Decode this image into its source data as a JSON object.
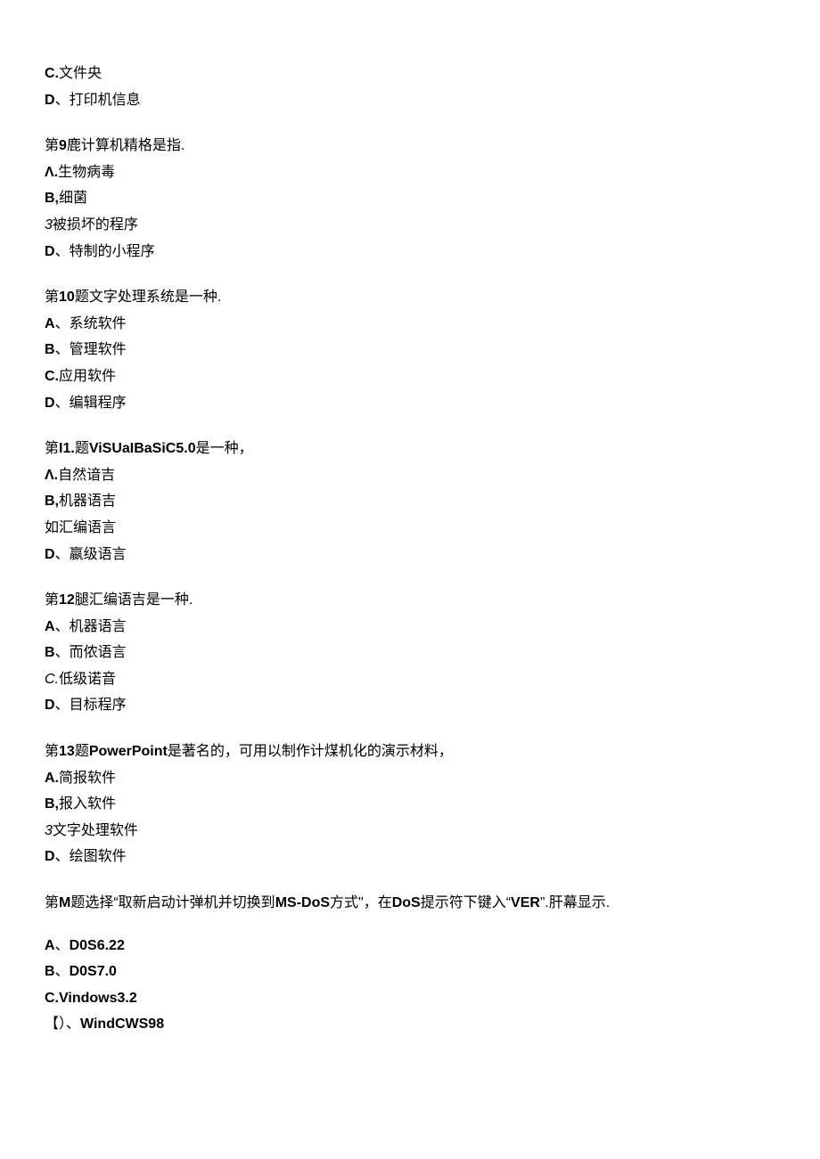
{
  "lines": [
    {
      "segments": [
        {
          "text": "C.",
          "bold": true
        },
        {
          "text": "文件央"
        }
      ]
    },
    {
      "segments": [
        {
          "text": "D",
          "bold": true
        },
        {
          "text": "、打印机信息"
        }
      ],
      "endBlock": true
    },
    {
      "segments": [
        {
          "text": "第"
        },
        {
          "text": "9",
          "bold": true
        },
        {
          "text": "鹿计算机精格是指."
        }
      ]
    },
    {
      "segments": [
        {
          "text": "Λ.",
          "bold": true
        },
        {
          "text": "生物病毒"
        }
      ]
    },
    {
      "segments": [
        {
          "text": "B,",
          "bold": true
        },
        {
          "text": "细菌"
        }
      ]
    },
    {
      "segments": [
        {
          "text": "3",
          "italic": true
        },
        {
          "text": "被损坏的程序"
        }
      ]
    },
    {
      "segments": [
        {
          "text": "D",
          "bold": true
        },
        {
          "text": "、特制的小程序"
        }
      ],
      "endBlock": true
    },
    {
      "segments": [
        {
          "text": "第"
        },
        {
          "text": "10",
          "bold": true
        },
        {
          "text": "题文字处理系统是一种."
        }
      ]
    },
    {
      "segments": [
        {
          "text": "A",
          "bold": true
        },
        {
          "text": "、系统软件"
        }
      ]
    },
    {
      "segments": [
        {
          "text": "B",
          "bold": true
        },
        {
          "text": "、管理软件"
        }
      ]
    },
    {
      "segments": [
        {
          "text": "C.",
          "bold": true
        },
        {
          "text": "应用软件"
        }
      ]
    },
    {
      "segments": [
        {
          "text": "D",
          "bold": true
        },
        {
          "text": "、编辑程序"
        }
      ],
      "endBlock": true
    },
    {
      "segments": [
        {
          "text": "第"
        },
        {
          "text": "I1.",
          "bold": true
        },
        {
          "text": "题"
        },
        {
          "text": "ViSUaIBaSiC5.0",
          "bold": true
        },
        {
          "text": "是一种，"
        }
      ]
    },
    {
      "segments": [
        {
          "text": "Λ.",
          "bold": true
        },
        {
          "text": "自然谙吉"
        }
      ]
    },
    {
      "segments": [
        {
          "text": "B,",
          "bold": true
        },
        {
          "text": "机器语吉"
        }
      ]
    },
    {
      "segments": [
        {
          "text": "如汇编语言"
        }
      ]
    },
    {
      "segments": [
        {
          "text": "D",
          "bold": true
        },
        {
          "text": "、嬴级语言"
        }
      ],
      "endBlock": true
    },
    {
      "segments": [
        {
          "text": "第"
        },
        {
          "text": "12",
          "bold": true
        },
        {
          "text": "腿汇编语吉是一种."
        }
      ]
    },
    {
      "segments": [
        {
          "text": "A",
          "bold": true
        },
        {
          "text": "、机器语言"
        }
      ]
    },
    {
      "segments": [
        {
          "text": "B",
          "bold": true
        },
        {
          "text": "、而侬语言"
        }
      ]
    },
    {
      "segments": [
        {
          "text": "C.",
          "italic": true
        },
        {
          "text": "低级诺音"
        }
      ]
    },
    {
      "segments": [
        {
          "text": "D",
          "bold": true
        },
        {
          "text": "、目标程序"
        }
      ],
      "endBlock": true
    },
    {
      "segments": [
        {
          "text": "第"
        },
        {
          "text": "13",
          "bold": true
        },
        {
          "text": "题"
        },
        {
          "text": "PowerPoint",
          "bold": true
        },
        {
          "text": "是著名的，可用以制作计煤机化的演示材料，"
        }
      ]
    },
    {
      "segments": [
        {
          "text": "A.",
          "bold": true
        },
        {
          "text": "简报软件"
        }
      ]
    },
    {
      "segments": [
        {
          "text": "B,",
          "bold": true
        },
        {
          "text": "报入软件"
        }
      ]
    },
    {
      "segments": [
        {
          "text": "3",
          "italic": true
        },
        {
          "text": "文字处理软件"
        }
      ]
    },
    {
      "segments": [
        {
          "text": "D",
          "bold": true
        },
        {
          "text": "、绘图软件"
        }
      ],
      "endBlock": true
    },
    {
      "segments": [
        {
          "text": "第"
        },
        {
          "text": "M",
          "bold": true
        },
        {
          "text": "题选择“取新启动计弹机并切换到"
        },
        {
          "text": "MS-DoS",
          "bold": true
        },
        {
          "text": "方式\"，在"
        },
        {
          "text": "DoS",
          "bold": true
        },
        {
          "text": "提示符下键入“"
        },
        {
          "text": "VER",
          "bold": true
        },
        {
          "text": "”."
        },
        {
          "text": "肝幕显示."
        }
      ],
      "endBlock": true,
      "smallGap": true
    },
    {
      "segments": [
        {
          "text": "A",
          "bold": true
        },
        {
          "text": "、"
        },
        {
          "text": "D0S6.22",
          "bold": true
        }
      ]
    },
    {
      "segments": [
        {
          "text": "B",
          "bold": true
        },
        {
          "text": "、"
        },
        {
          "text": "D0S7.0",
          "bold": true
        }
      ]
    },
    {
      "segments": [
        {
          "text": "C.Vindows3.2",
          "bold": true
        }
      ]
    },
    {
      "segments": [
        {
          "text": "【）、"
        },
        {
          "text": "WindCWS98",
          "bold": true
        }
      ]
    }
  ]
}
